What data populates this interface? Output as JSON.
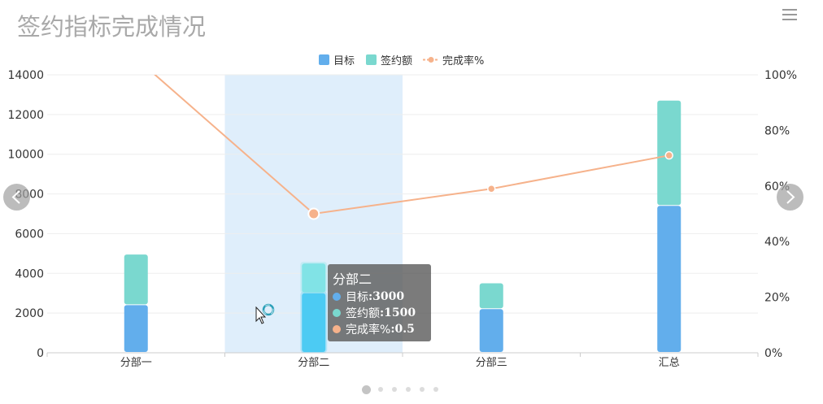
{
  "page": {
    "title": "签约指标完成情况"
  },
  "chart_data": {
    "type": "bar",
    "title": "签约指标完成情况",
    "categories": [
      "分部一",
      "分部二",
      "分部三",
      "汇总"
    ],
    "series": [
      {
        "name": "目标",
        "type": "bar",
        "stack": "total",
        "axis": "left",
        "color": "#62aeec",
        "values": [
          2400,
          3000,
          2200,
          7400
        ]
      },
      {
        "name": "签约额",
        "type": "bar",
        "stack": "total",
        "axis": "left",
        "color": "#7ad8cf",
        "values": [
          2550,
          1500,
          1300,
          5300
        ]
      },
      {
        "name": "完成率%",
        "type": "line",
        "axis": "right",
        "color": "#f6b28b",
        "values": [
          1.06,
          0.5,
          0.59,
          0.71
        ]
      }
    ],
    "y_left": {
      "min": 0,
      "max": 14000,
      "ticks": [
        0,
        2000,
        4000,
        6000,
        8000,
        10000,
        12000,
        14000
      ]
    },
    "y_right": {
      "min": 0,
      "max": 1,
      "ticks": [
        "0%",
        "20%",
        "40%",
        "60%",
        "80%",
        "100%"
      ]
    },
    "legend": {
      "placement": "top-center",
      "items": [
        "目标",
        "签约额",
        "完成率%"
      ]
    },
    "grid": true,
    "highlighted_category": "分部二",
    "tooltip": {
      "title": "分部二",
      "rows": [
        {
          "name": "目标",
          "value": "3000",
          "color": "#62aeec"
        },
        {
          "name": "签约额",
          "value": "1500",
          "color": "#7ad8cf"
        },
        {
          "name": "完成率%",
          "value": "0.5",
          "color": "#f6b28b"
        }
      ]
    }
  },
  "carousel": {
    "page_count": 6,
    "active_index": 0
  },
  "colors": {
    "title": "#a9a9a9",
    "axis_text": "#333333",
    "grid": "#eeeeee",
    "highlight_band": "#dfeefb"
  }
}
